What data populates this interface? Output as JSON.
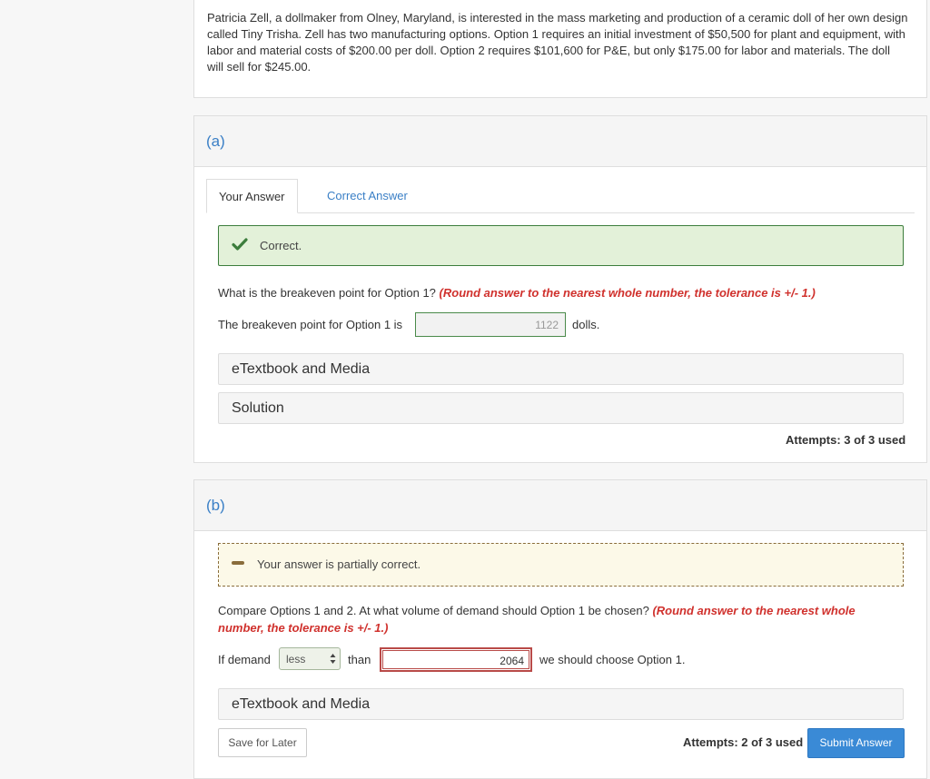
{
  "intro": {
    "text": "Patricia Zell, a dollmaker from Olney, Maryland, is interested in the mass marketing and production of a ceramic doll of her own design called Tiny Trisha. Zell has two manufacturing options. Option 1 requires an initial investment of $50,500 for plant and equipment, with labor and material costs of $200.00 per doll. Option 2 requires $101,600 for P&E, but only $175.00 for labor and materials. The doll will sell for $245.00."
  },
  "part_a": {
    "label": "(a)",
    "tabs": [
      {
        "label": "Your Answer",
        "active": true
      },
      {
        "label": "Correct Answer",
        "active": false
      }
    ],
    "feedback": {
      "icon": "check-icon",
      "text": "Correct."
    },
    "question": "What is the breakeven point for Option 1?",
    "hint": "(Round answer to the nearest whole number, the tolerance is +/- 1.)",
    "answer_prefix": "The breakeven point for Option 1 is",
    "answer_value": "1122",
    "answer_suffix": "dolls.",
    "resources": [
      {
        "label": "eTextbook and Media"
      },
      {
        "label": "Solution"
      }
    ],
    "attempts": "Attempts: 3 of 3 used"
  },
  "part_b": {
    "label": "(b)",
    "feedback": {
      "icon": "dash-icon",
      "text": "Your answer is partially correct."
    },
    "question": "Compare Options 1 and 2. At what volume of demand should Option 1 be chosen?",
    "hint": "(Round answer to the nearest whole number, the tolerance is +/- 1.)",
    "answer_prefix": "If demand",
    "select_value": "less",
    "answer_middle": "than",
    "answer_value": "2064",
    "answer_suffix": "we should choose Option 1.",
    "resources": [
      {
        "label": "eTextbook and Media"
      }
    ],
    "save_label": "Save for Later",
    "attempts": "Attempts: 2 of 3 used",
    "submit_label": "Submit Answer"
  },
  "colors": {
    "link": "#3a7fc6",
    "correct_bg": "#e3f1d9",
    "correct_border": "#3c7d3c",
    "partial_bg": "#fcf9e8",
    "partial_border": "#8a6d3b",
    "hint": "#d0312d",
    "submit": "#3a8ad6"
  }
}
